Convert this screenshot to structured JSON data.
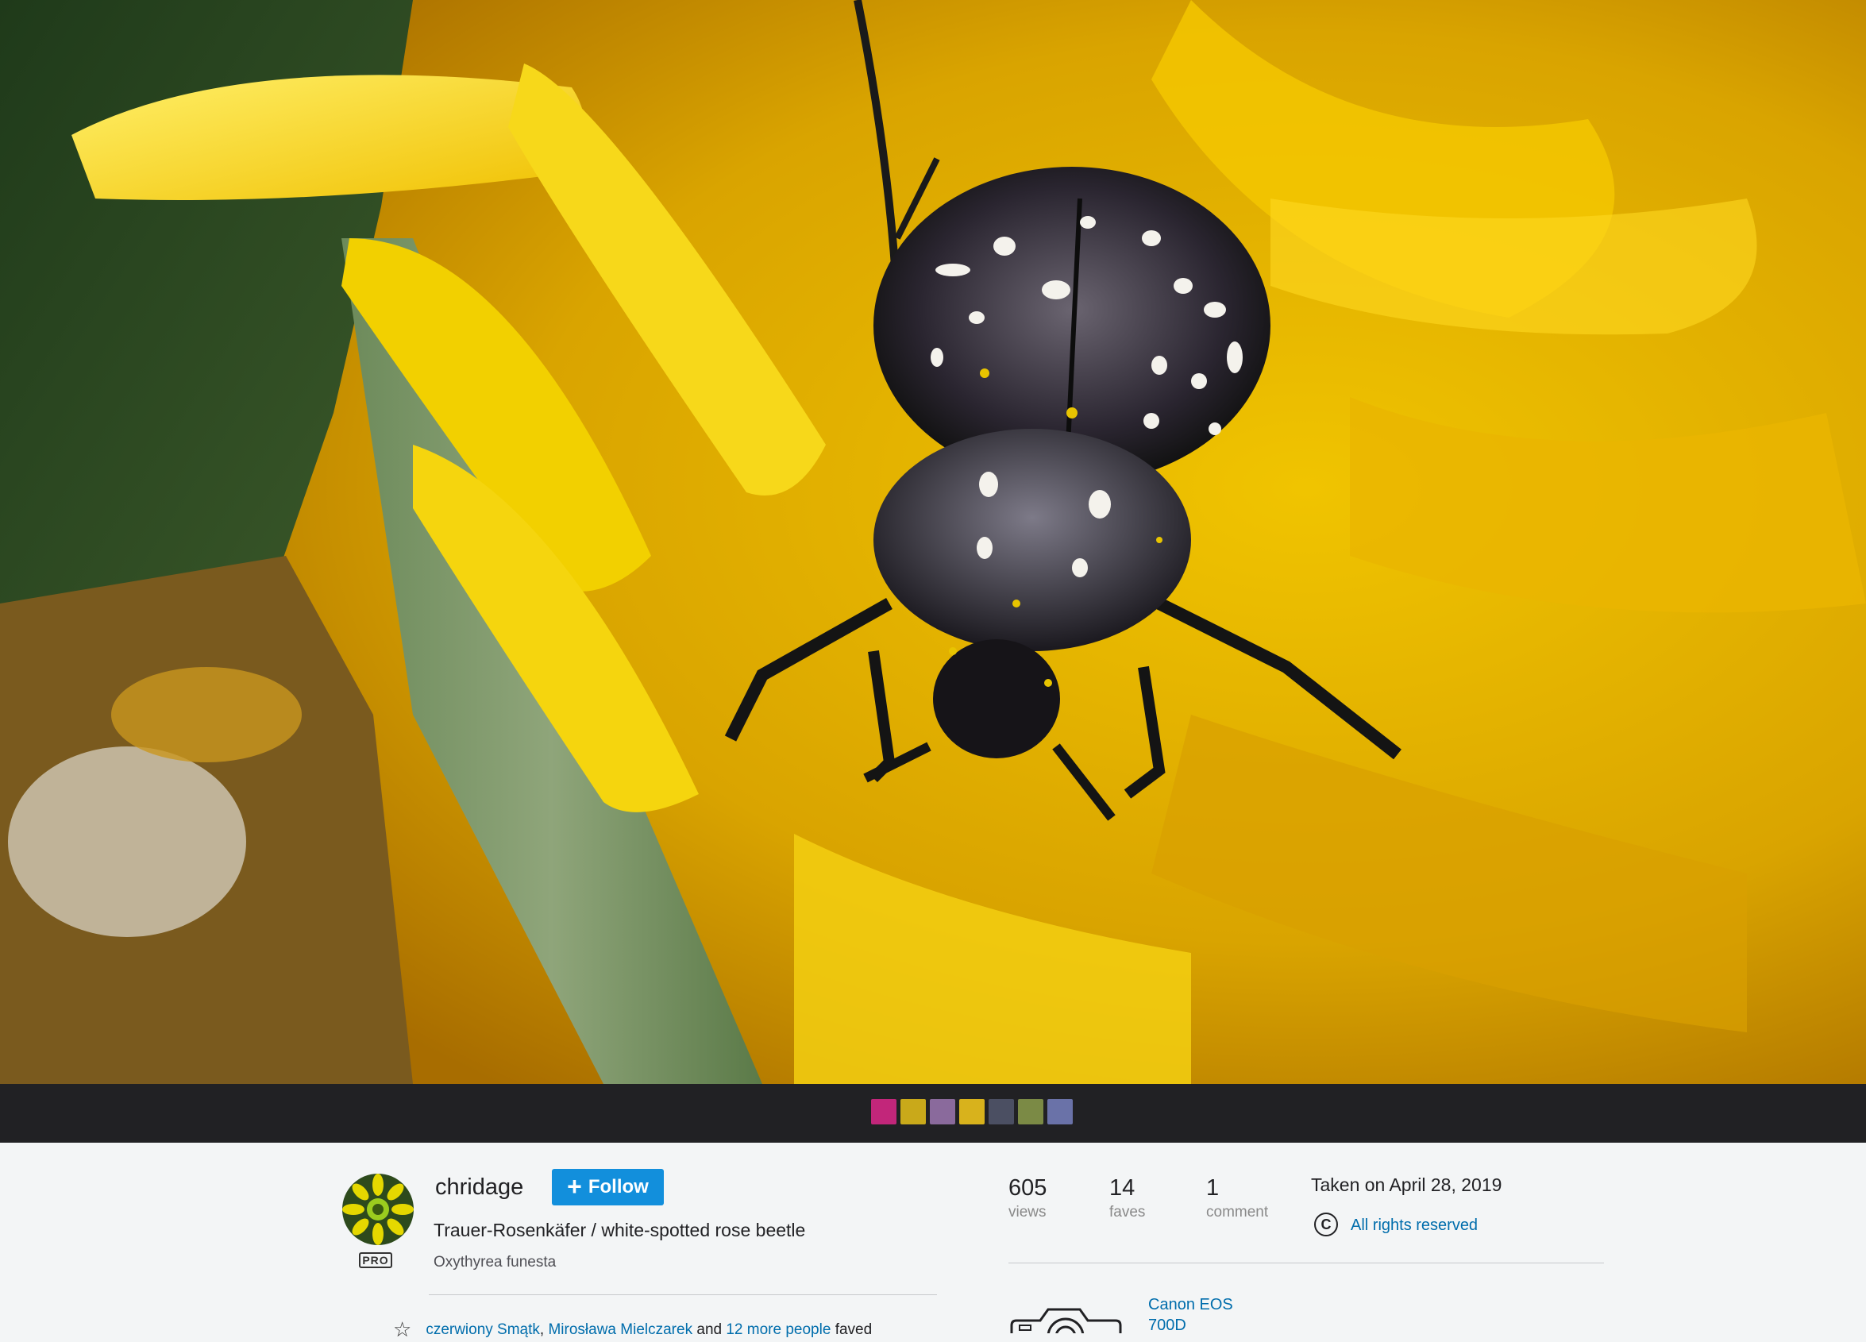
{
  "owner": {
    "username": "chridage",
    "badge": "PRO",
    "follow_label": "Follow"
  },
  "photo": {
    "title": "Trauer-Rosenkäfer / white-spotted rose beetle",
    "description": "Oxythyrea funesta"
  },
  "stats": {
    "views": {
      "value": "605",
      "label": "views"
    },
    "faves": {
      "value": "14",
      "label": "faves"
    },
    "comments": {
      "value": "1",
      "label": "comment"
    }
  },
  "taken": "Taken on April 28, 2019",
  "license": "All rights reserved",
  "camera": "Canon EOS 700D",
  "faved_by": {
    "person1": "czerwiony Smątk",
    "separator": ",",
    "person2": "Mirosława Mielczarek",
    "and": "and",
    "more": "12 more people",
    "suffix": "faved"
  },
  "filmstrip": [
    {
      "name": "thumb-1",
      "color": "#c2267a"
    },
    {
      "name": "thumb-2",
      "color": "#c9a91a"
    },
    {
      "name": "thumb-3",
      "color": "#8a6a9c"
    },
    {
      "name": "thumb-4",
      "color": "#d8b21c"
    },
    {
      "name": "thumb-5",
      "color": "#4b4f62"
    },
    {
      "name": "thumb-6",
      "color": "#7b8a45"
    },
    {
      "name": "thumb-7",
      "color": "#6a72a8"
    }
  ],
  "colors": {
    "accent": "#128fdc",
    "link": "#006dac",
    "filmstrip_bg": "#212124"
  }
}
